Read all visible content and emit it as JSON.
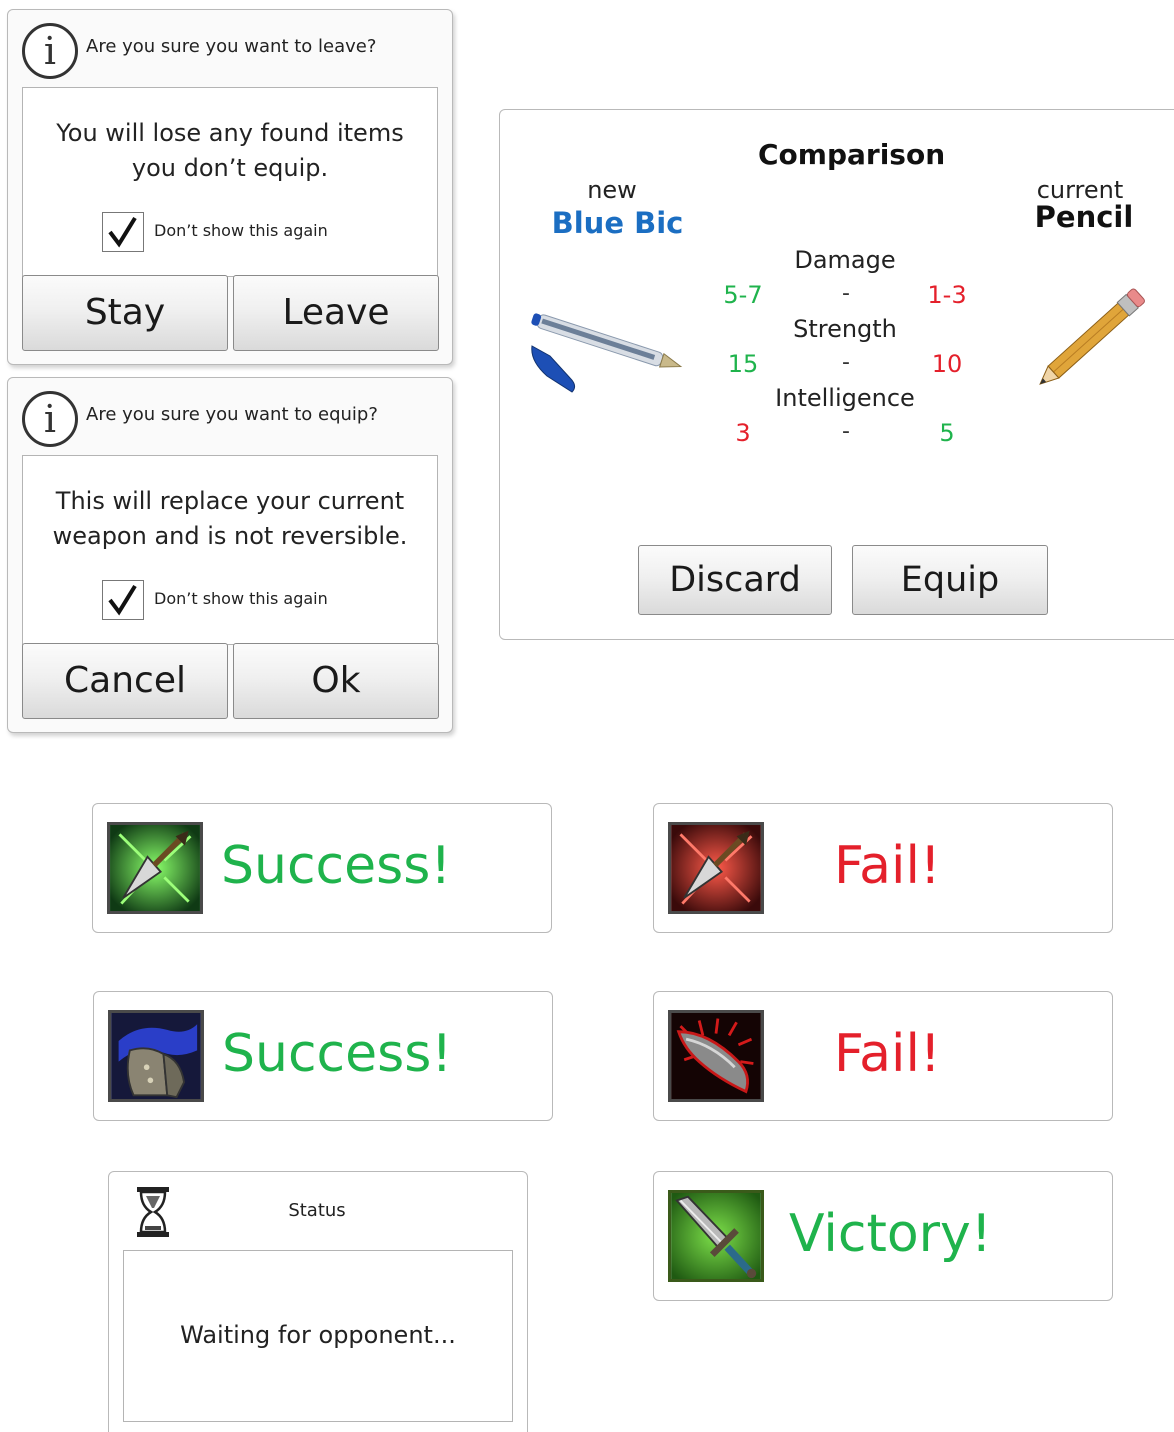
{
  "leave_dialog": {
    "title": "Are you sure you want to leave?",
    "message": "You will lose any found items you don’t equip.",
    "checkbox_label": "Don’t show this again",
    "checkbox_checked": true,
    "stay_label": "Stay",
    "leave_label": "Leave"
  },
  "equip_dialog": {
    "title": "Are you sure you want to equip?",
    "message": "This will replace your current weapon and is not reversible.",
    "checkbox_label": "Don’t show this again",
    "checkbox_checked": true,
    "cancel_label": "Cancel",
    "ok_label": "Ok"
  },
  "comparison": {
    "title": "Comparison",
    "new_label": "new",
    "new_item": "Blue Bic",
    "current_label": "current",
    "current_item": "Pencil",
    "stats": [
      {
        "name": "Damage",
        "new": "5-7",
        "separator": "-",
        "current": "1-3"
      },
      {
        "name": "Strength",
        "new": "15",
        "separator": "-",
        "current": "10"
      },
      {
        "name": "Intelligence",
        "new": "3",
        "separator": "-",
        "current": "5"
      }
    ],
    "discard_label": "Discard",
    "equip_label": "Equip"
  },
  "results": [
    {
      "text": "Success!",
      "icon": "arrow-icon",
      "outcome": "success"
    },
    {
      "text": "Fail!",
      "icon": "arrow-icon",
      "outcome": "fail"
    },
    {
      "text": "Success!",
      "icon": "armor-icon",
      "outcome": "success"
    },
    {
      "text": "Fail!",
      "icon": "blade-icon",
      "outcome": "fail"
    }
  ],
  "status": {
    "title": "Status",
    "message": "Waiting for opponent...",
    "icon": "hourglass-icon"
  },
  "victory": {
    "text": "Victory!",
    "icon": "sword-icon"
  },
  "colors": {
    "success": "#1fb34c",
    "fail": "#e4202b",
    "new_item": "#1b6ec2"
  }
}
